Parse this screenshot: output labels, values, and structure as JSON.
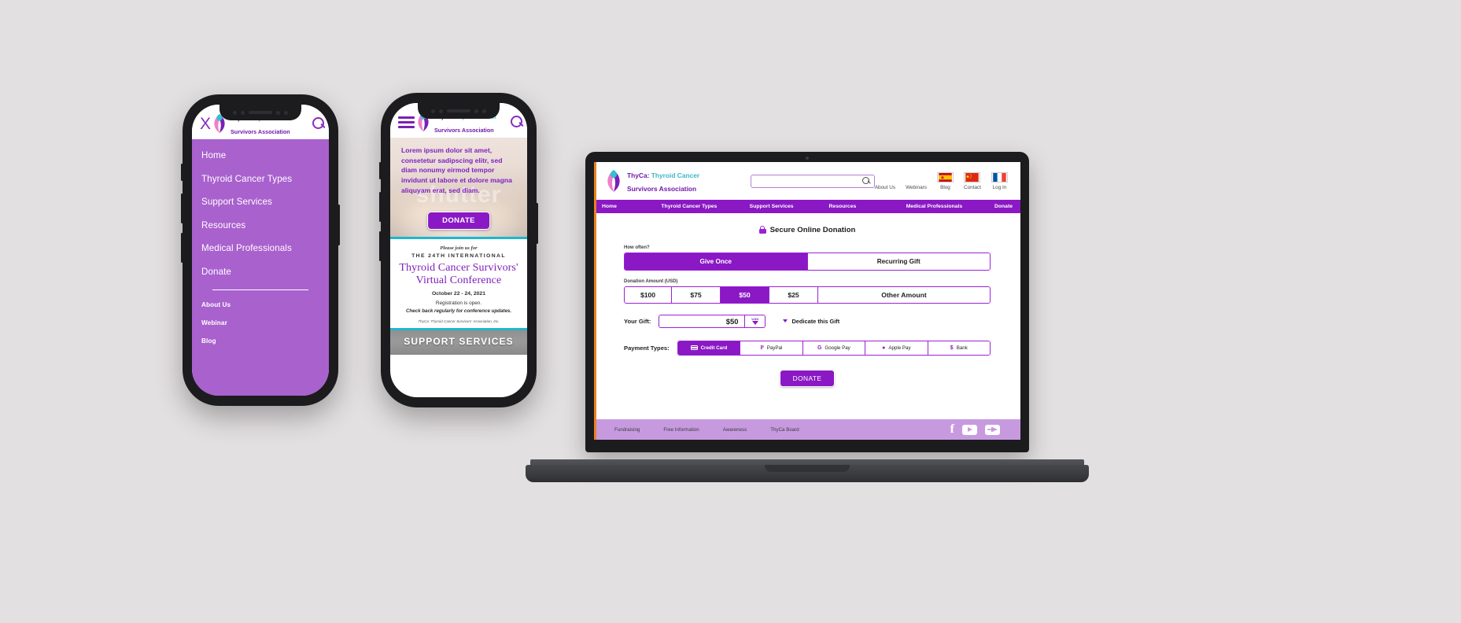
{
  "brand": {
    "name_part1": "ThyCa",
    "name_colon": ":",
    "name_part2": " Thyroid Cancer",
    "name_line2": "Survivors Association",
    "accent_purple": "#8a18c4",
    "accent_light_purple": "#a961ce",
    "accent_teal": "#1fb6cd",
    "accent_pink": "#f07ec8"
  },
  "phone_menu": {
    "close_label": "X",
    "search_icon": "search-icon",
    "items": [
      {
        "label": "Home"
      },
      {
        "label": "Thyroid Cancer Types"
      },
      {
        "label": "Support Services"
      },
      {
        "label": "Resources"
      },
      {
        "label": "Medical Professionals"
      },
      {
        "label": "Donate"
      }
    ],
    "secondary_items": [
      {
        "label": "About Us"
      },
      {
        "label": "Webinar"
      },
      {
        "label": "Blog"
      }
    ]
  },
  "phone_content": {
    "menu_icon": "hamburger-icon",
    "search_icon": "search-icon",
    "hero_paragraph": "Lorem ipsum dolor sit amet, consetetur sadipscing elitr, sed diam nonumy eirmod tempor invidunt ut labore et dolore magna aliquyam erat, sed diam.",
    "hero_watermark": "shutter",
    "hero_donate_label": "DONATE",
    "flyer": {
      "join_line": "Please join us for",
      "kicker": "THE 24TH INTERNATIONAL",
      "title_line1": "Thyroid Cancer Survivors'",
      "title_line2": "Virtual Conference",
      "date": "October 22 - 24, 2021",
      "registration": "Registration is open.",
      "check_back": "Check back regularly for conference updates.",
      "org": "ThyCa:  Thyroid Cancer Survivors' Association, Inc."
    },
    "section_banner": "SUPPORT SERVICES"
  },
  "laptop": {
    "search": {
      "placeholder": "",
      "value": "",
      "icon": "search-icon"
    },
    "utility_links": [
      {
        "label": "About Us",
        "flag": "none"
      },
      {
        "label": "Webinars",
        "flag": "none"
      },
      {
        "label": "Blog",
        "flag": "spain-flag"
      },
      {
        "label": "Contact",
        "flag": "china-flag"
      },
      {
        "label": "Log In",
        "flag": "france-flag"
      }
    ],
    "nav": [
      {
        "label": "Home"
      },
      {
        "label": "Thyroid Cancer Types"
      },
      {
        "label": "Support Services"
      },
      {
        "label": "Resources"
      },
      {
        "label": "Medical Professionals"
      },
      {
        "label": "Donate"
      }
    ],
    "form": {
      "title": "Secure Online Donation",
      "lock_icon": "lock-icon",
      "how_often_label": "How often?",
      "frequency_options": [
        {
          "label": "Give Once",
          "selected": true
        },
        {
          "label": "Recurring Gift",
          "selected": false
        }
      ],
      "amount_label": "Donation Amount (USD)",
      "amount_options": [
        {
          "label": "$100",
          "selected": false
        },
        {
          "label": "$75",
          "selected": false
        },
        {
          "label": "$50",
          "selected": true
        },
        {
          "label": "$25",
          "selected": false
        },
        {
          "label": "Other Amount",
          "selected": false
        }
      ],
      "your_gift_label": "Your Gift:",
      "your_gift_value": "$50",
      "currency_code": "USD",
      "dedicate_label": "Dedicate this Gift",
      "payment_types_label": "Payment Types:",
      "payment_options": [
        {
          "label": "Credit Card",
          "icon": "credit-card-icon",
          "selected": true
        },
        {
          "label": "PayPal",
          "icon": "paypal-icon",
          "selected": false
        },
        {
          "label": "Google Pay",
          "icon": "google-pay-icon",
          "selected": false
        },
        {
          "label": "Apple Pay",
          "icon": "apple-pay-icon",
          "selected": false
        },
        {
          "label": "Bank",
          "icon": "bank-icon",
          "selected": false
        }
      ],
      "payment_glyphs": [
        "",
        "P",
        "G",
        "\u0001",
        "$"
      ],
      "submit_label": "DONATE"
    },
    "footer": {
      "links": [
        {
          "label": "Fundraising"
        },
        {
          "label": "Free Information"
        },
        {
          "label": "Awareness"
        },
        {
          "label": "ThyCa Board"
        }
      ],
      "socials": [
        {
          "name": "facebook-icon"
        },
        {
          "name": "youtube-icon"
        },
        {
          "name": "twitter-icon"
        }
      ]
    }
  }
}
